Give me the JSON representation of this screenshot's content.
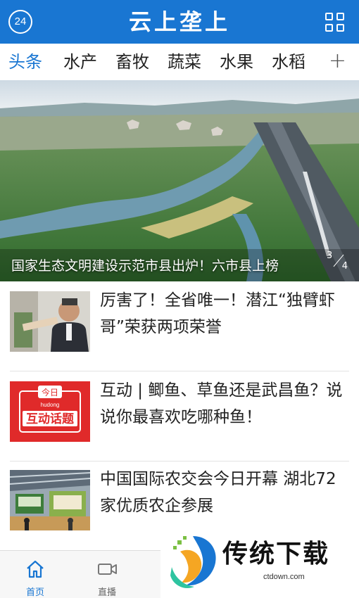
{
  "header": {
    "badge": "24",
    "title": "云上垄上"
  },
  "tabs": [
    {
      "label": "头条",
      "active": true
    },
    {
      "label": "水产",
      "active": false
    },
    {
      "label": "畜牧",
      "active": false
    },
    {
      "label": "蔬菜",
      "active": false
    },
    {
      "label": "水果",
      "active": false
    },
    {
      "label": "水稻",
      "active": false
    }
  ],
  "tabs_more": "+",
  "hero": {
    "caption": "国家生态文明建设示范市县出炉！六市县上榜",
    "page_current": "3",
    "page_total": "4"
  },
  "news": [
    {
      "headline": "厉害了！全省唯一！潜江“独臂虾哥”荣获两项荣誉",
      "thumb": "person-photo"
    },
    {
      "headline": "互动 | 鲫鱼、草鱼还是武昌鱼？说说你最喜欢吃哪种鱼！",
      "thumb": "interactive-topic-graphic",
      "thumb_text": {
        "top": "今日",
        "mid": "hudong",
        "main": "互动话题"
      }
    },
    {
      "headline": "中国国际农交会今日开幕 湖北72家优质农企参展",
      "thumb": "expo-hall-photo"
    }
  ],
  "bottom_nav": [
    {
      "label": "首页",
      "icon": "home-icon",
      "active": true
    },
    {
      "label": "直播",
      "icon": "video-camera-icon",
      "active": false
    }
  ],
  "watermark": {
    "text": "传统下载",
    "url": "ctdown.com"
  },
  "colors": {
    "primary": "#1976d2",
    "tab_active": "#1976d2",
    "interactive_red": "#e02a2a"
  }
}
